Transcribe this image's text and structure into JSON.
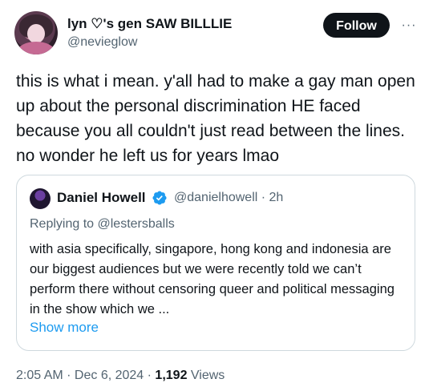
{
  "author": {
    "display_name": "lyn ♡'s gen SAW BILLLIE",
    "handle": "@nevieglow",
    "follow_label": "Follow",
    "more_icon": "···"
  },
  "tweet": {
    "text": "this is what i mean. y'all had to make a gay man open up about the personal discrimination HE faced because you all couldn't just read between the lines. no wonder he left us for years lmao"
  },
  "quote": {
    "name": "Daniel Howell",
    "handle_time": "@danielhowell · 2h",
    "replying_prefix": "Replying to ",
    "replying_to": "@lestersballs",
    "text": "with asia specifically, singapore, hong kong and indonesia are our biggest audiences but we were recently told we can’t perform there without censoring queer and political messaging in the show which we ...",
    "show_more": "Show more",
    "verified_color": "#1d9bf0"
  },
  "meta": {
    "time": "2:05 AM",
    "sep1": " · ",
    "date": "Dec 6, 2024",
    "sep2": " · ",
    "views_count": "1,192",
    "views_label": " Views"
  }
}
